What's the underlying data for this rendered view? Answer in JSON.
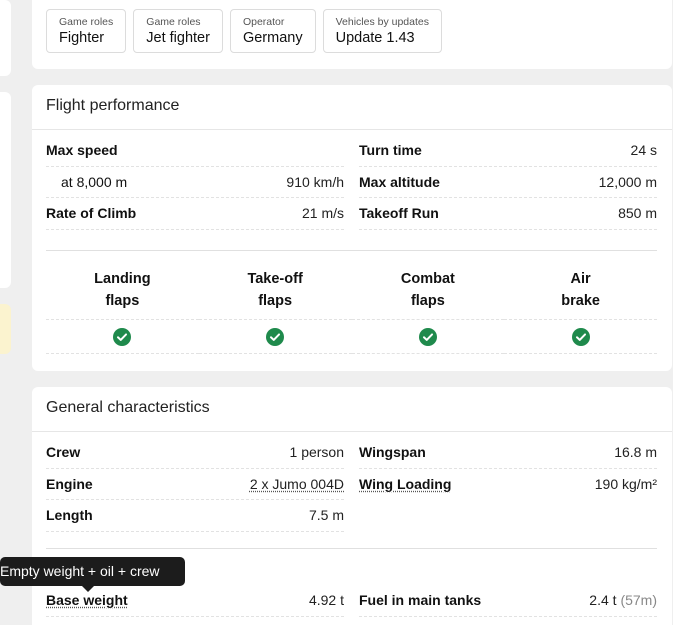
{
  "tags": [
    {
      "label": "Game roles",
      "value": "Fighter"
    },
    {
      "label": "Game roles",
      "value": "Jet fighter"
    },
    {
      "label": "Operator",
      "value": "Germany"
    },
    {
      "label": "Vehicles by updates",
      "value": "Update 1.43"
    }
  ],
  "flight": {
    "title": "Flight performance",
    "left": [
      {
        "label": "Max speed",
        "value": ""
      },
      {
        "label": "at 8,000 m",
        "value": "910 km/h"
      },
      {
        "label": "Rate of Climb",
        "value": "21 m/s"
      }
    ],
    "right": [
      {
        "label": "Turn time",
        "value": "24 s"
      },
      {
        "label": "Max altitude",
        "value": "12,000 m"
      },
      {
        "label": "Takeoff Run",
        "value": "850 m"
      }
    ],
    "flaps": [
      {
        "line1": "Landing",
        "line2": "flaps",
        "status": "check-icon"
      },
      {
        "line1": "Take-off",
        "line2": "flaps",
        "status": "check-icon"
      },
      {
        "line1": "Combat",
        "line2": "flaps",
        "status": "check-icon"
      },
      {
        "line1": "Air",
        "line2": "brake",
        "status": "check-icon"
      }
    ],
    "check_color": "#1f8a4c"
  },
  "general": {
    "title": "General characteristics",
    "left": [
      {
        "label": "Crew",
        "value": "1 person"
      },
      {
        "label": "Engine",
        "value": "2 x Jumo 004D"
      },
      {
        "label": "Length",
        "value": "7.5 m"
      }
    ],
    "right": [
      {
        "label": "Wingspan",
        "value": "16.8 m"
      },
      {
        "label": "Wing Loading",
        "value": "190 kg/m²"
      }
    ],
    "weight": {
      "base_label": "Base weight",
      "base_value": "4.92 t",
      "fuel_label": "Fuel in main tanks",
      "fuel_value": "2.4 t",
      "fuel_extra": "(57m)"
    }
  },
  "tooltip": "Empty weight + oil + crew"
}
